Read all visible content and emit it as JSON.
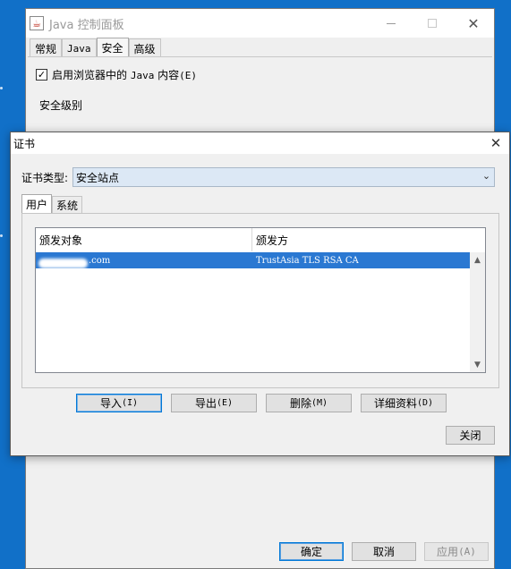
{
  "control_panel": {
    "title": "Java 控制面板",
    "title_icon": "java-cup-icon",
    "tabs": [
      {
        "label": "常规",
        "active": false
      },
      {
        "label": "Java",
        "active": false
      },
      {
        "label": "安全",
        "active": true
      },
      {
        "label": "高级",
        "active": false
      }
    ],
    "enable_java_checkbox": {
      "checked": true,
      "label_prefix": "启用浏览器中的 ",
      "label_mono": "Java",
      "label_mid": " 内容",
      "label_mnemonic": "(E)"
    },
    "security_level_label": "安全级别",
    "buttons": {
      "ok": "确定",
      "cancel": "取消",
      "apply_text": "应用",
      "apply_mnemonic": "(A)"
    }
  },
  "certificates_dialog": {
    "title": "证书",
    "type_label": "证书类型:",
    "type_value": "安全站点",
    "tabs": [
      {
        "label": "用户",
        "active": true
      },
      {
        "label": "系统",
        "active": false
      }
    ],
    "table": {
      "columns": [
        "颁发对象",
        "颁发方"
      ],
      "rows": [
        {
          "issued_to_visible": ".com",
          "issued_by": "TrustAsia TLS RSA CA",
          "selected": true
        }
      ]
    },
    "actions": [
      {
        "text": "导入",
        "mnemonic": "(I)"
      },
      {
        "text": "导出",
        "mnemonic": "(E)"
      },
      {
        "text": "删除",
        "mnemonic": "(M)"
      },
      {
        "text": "详细资料",
        "mnemonic": "(D)"
      }
    ],
    "close_label": "关闭"
  },
  "colors": {
    "desktop": "#1170c8",
    "selection": "#2a78d2",
    "focus": "#0078d7"
  }
}
